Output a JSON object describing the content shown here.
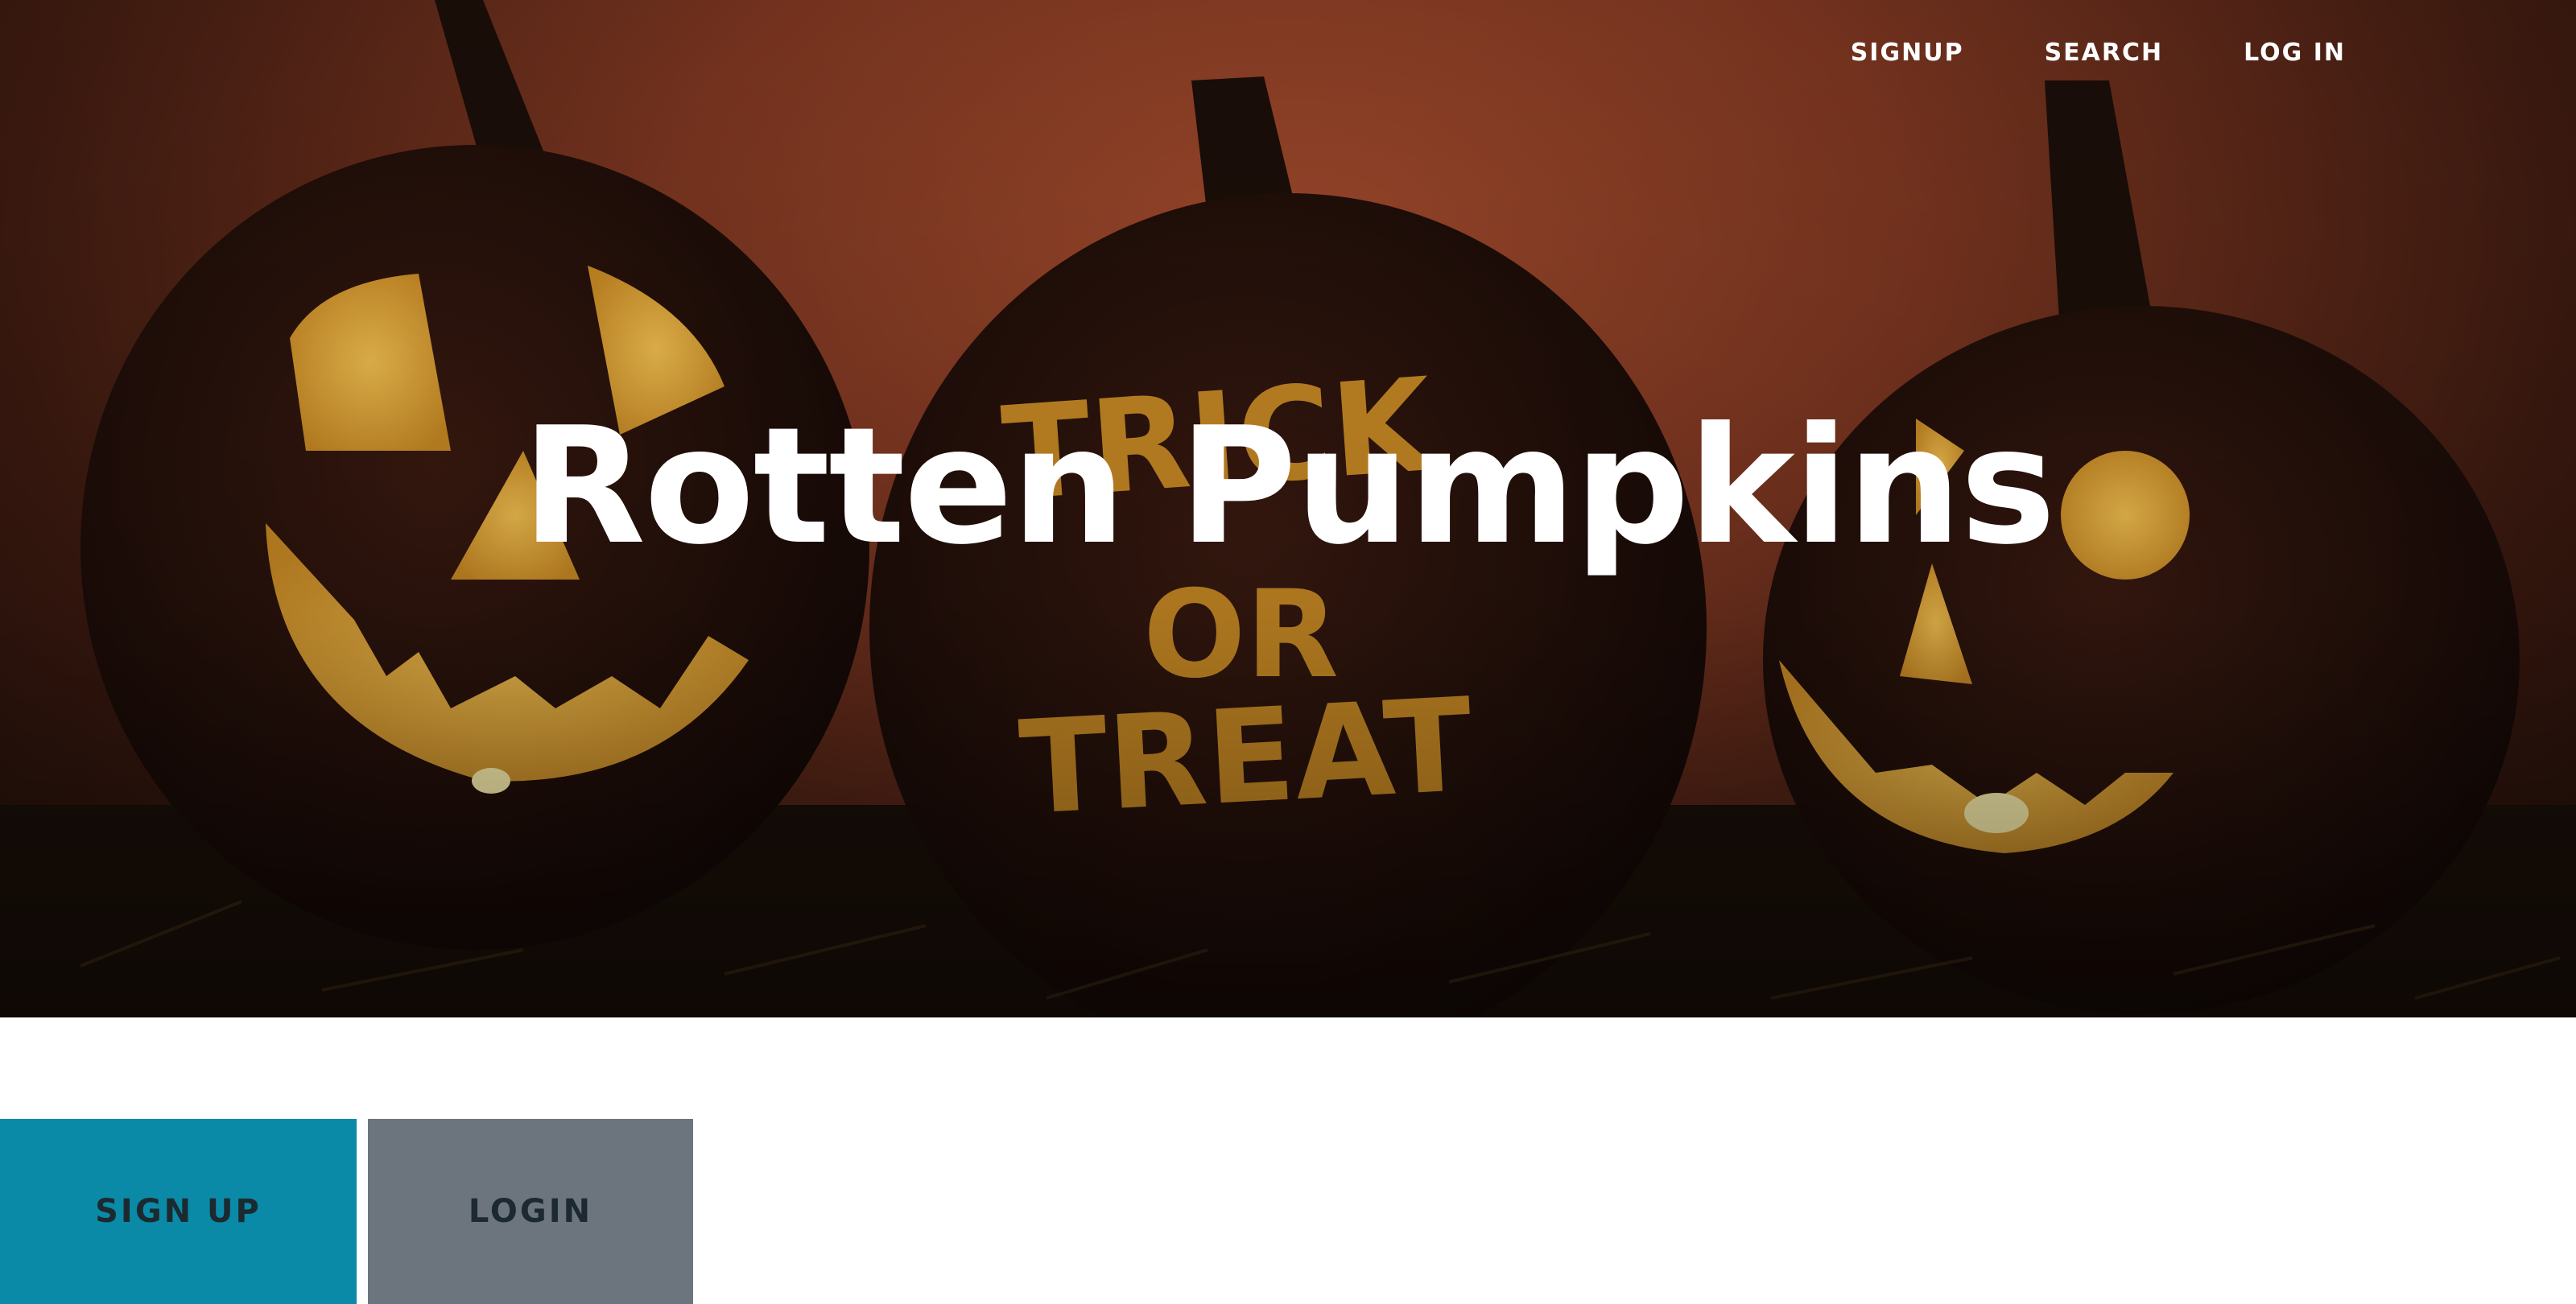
{
  "nav": {
    "signup_label": "SIGNUP",
    "search_label": "SEARCH",
    "login_label": "LOG IN"
  },
  "hero": {
    "title": "Rotten Pumpkins",
    "carved_text": [
      "TRICK",
      "OR",
      "TREAT"
    ]
  },
  "buttons": {
    "signup_label": "SIGN UP",
    "login_label": "LOGIN"
  },
  "colors": {
    "signup_button": "#0a8aa7",
    "login_button": "#6c757d",
    "button_text": "#1c2a30",
    "hero_text": "#ffffff",
    "carved_glow": "#d99a2b"
  }
}
